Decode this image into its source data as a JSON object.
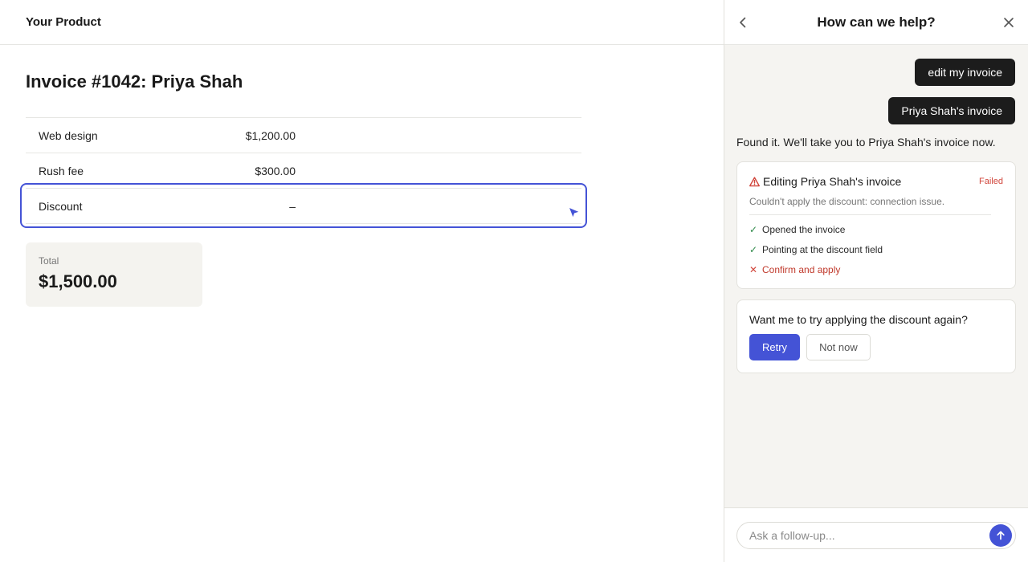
{
  "app": {
    "brand": "Your Product",
    "invoice_title": "Invoice #1042: Priya Shah",
    "line_items": [
      {
        "description": "Web design",
        "amount": "$1,200.00"
      },
      {
        "description": "Rush fee",
        "amount": "$300.00"
      },
      {
        "description": "Discount",
        "amount": "–"
      }
    ],
    "total": {
      "label": "Total",
      "value": "$1,500.00"
    }
  },
  "help_panel": {
    "title": "How can we help?",
    "icons": {
      "back": "chevron-left-icon",
      "close": "close-icon"
    },
    "messages": [
      {
        "role": "user",
        "text": "edit my invoice"
      },
      {
        "role": "user",
        "text": "Priya Shah's invoice"
      },
      {
        "role": "assistant",
        "text": "Found it. We'll take you to Priya Shah's invoice now."
      }
    ],
    "task": {
      "title": "Editing Priya Shah's invoice",
      "status": "Failed",
      "error": "Couldn't apply the discount: connection issue.",
      "steps": [
        {
          "label": "Opened the invoice",
          "state": "done",
          "icon": "check-icon"
        },
        {
          "label": "Pointing at the discount field",
          "state": "done",
          "icon": "check-icon"
        },
        {
          "label": "Confirm and apply",
          "state": "failed",
          "icon": "x-icon"
        }
      ]
    },
    "retry": {
      "question": "Want me to try applying the discount again?",
      "retry_label": "Retry",
      "dismiss_label": "Not now"
    },
    "composer": {
      "placeholder": "Ask a follow-up..."
    }
  },
  "colors": {
    "accent": "#4453d6",
    "error": "#d1453b",
    "success": "#2f8a4a",
    "user_bubble": "#1c1c1c",
    "panel_bg": "#f5f4f1"
  }
}
